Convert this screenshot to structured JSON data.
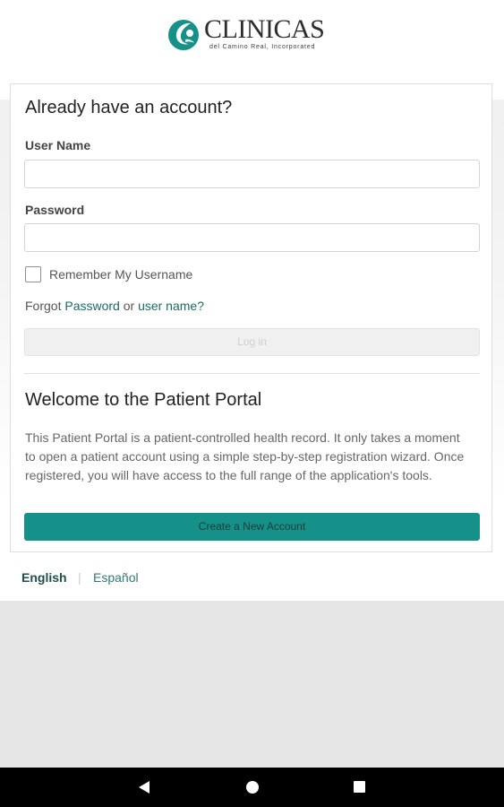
{
  "logo": {
    "wordmark": "CLINICAS",
    "tagline": "del Camino Real, Incorporated",
    "icon": "clinicas-logo-icon",
    "brand_color": "#15918a"
  },
  "login": {
    "heading": "Already have an account?",
    "username_label": "User Name",
    "username_value": "",
    "password_label": "Password",
    "password_value": "",
    "remember_label": "Remember My Username",
    "remember_checked": false,
    "forgot_prefix": "Forgot ",
    "forgot_password_link": "Password",
    "forgot_or": " or ",
    "forgot_username_link": "user name?",
    "login_button": "Log in"
  },
  "welcome": {
    "heading": "Welcome to the Patient Portal",
    "body": "This Patient Portal is a patient-controlled health record. It only takes a moment to open a patient account using a simple step-by-step registration wizard. Once registered, you will have access to the full range of the application's tools.",
    "create_button": "Create a New Account"
  },
  "languages": {
    "english": "English",
    "separator": "|",
    "spanish": "Español"
  },
  "android_nav": {
    "back_icon": "back-triangle-icon",
    "home_icon": "home-circle-icon",
    "recents_icon": "recents-square-icon"
  },
  "colors": {
    "accent": "#15918a",
    "link": "#1a6b66",
    "nav_bar": "#000000"
  }
}
